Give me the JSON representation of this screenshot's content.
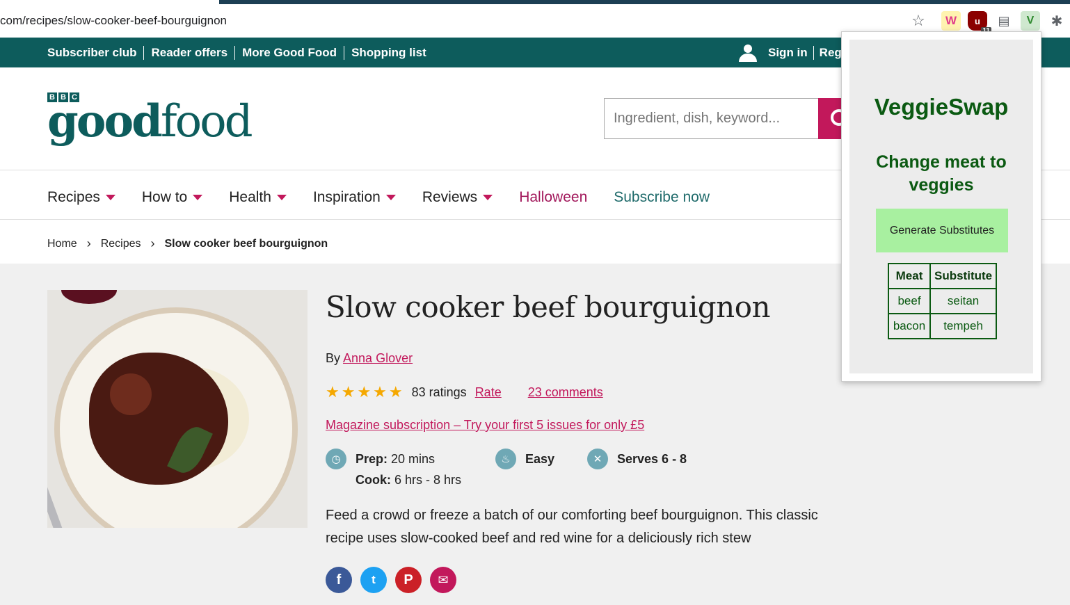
{
  "browser": {
    "url_prefix": "com/recipes/slow-cooker-beef-bourguignon",
    "ublock_badge": "11"
  },
  "utility_nav": {
    "links": [
      "Subscriber club",
      "Reader offers",
      "More Good Food",
      "Shopping list"
    ],
    "sign_in": "Sign in",
    "register": "Regi"
  },
  "logo": {
    "bbc": [
      "B",
      "B",
      "C"
    ],
    "word_good": "good",
    "word_food": "food"
  },
  "search": {
    "placeholder": "Ingredient, dish, keyword..."
  },
  "main_nav": {
    "recipes": "Recipes",
    "how_to": "How to",
    "health": "Health",
    "inspiration": "Inspiration",
    "reviews": "Reviews",
    "halloween": "Halloween",
    "subscribe": "Subscribe now"
  },
  "breadcrumb": {
    "home": "Home",
    "recipes": "Recipes",
    "current": "Slow cooker beef bourguignon"
  },
  "recipe": {
    "title": "Slow cooker beef bourguignon",
    "by": "By",
    "author": "Anna Glover",
    "stars": "★★★★★",
    "ratings": "83 ratings",
    "rate": "Rate",
    "comments": "23 comments",
    "magazine": "Magazine subscription – Try your first 5 issues for only £5",
    "prep_label": "Prep:",
    "prep_value": "20 mins",
    "cook_label": "Cook:",
    "cook_value": "6 hrs - 8 hrs",
    "difficulty": "Easy",
    "serves": "Serves 6 - 8",
    "description": "Feed a crowd or freeze a batch of our comforting beef bourguignon. This classic recipe uses slow-cooked beef and red wine for a deliciously rich stew"
  },
  "popup": {
    "title": "VeggieSwap",
    "subtitle": "Change meat to veggies",
    "button": "Generate Substitutes",
    "table_headers": [
      "Meat",
      "Substitute"
    ],
    "rows": [
      {
        "meat": "beef",
        "substitute": "seitan"
      },
      {
        "meat": "bacon",
        "substitute": "tempeh"
      }
    ]
  },
  "colors": {
    "brand_teal": "#0d5c5c",
    "accent_pink": "#c2185b",
    "popup_green": "#0b5a12",
    "button_green": "#a8f0a0"
  }
}
